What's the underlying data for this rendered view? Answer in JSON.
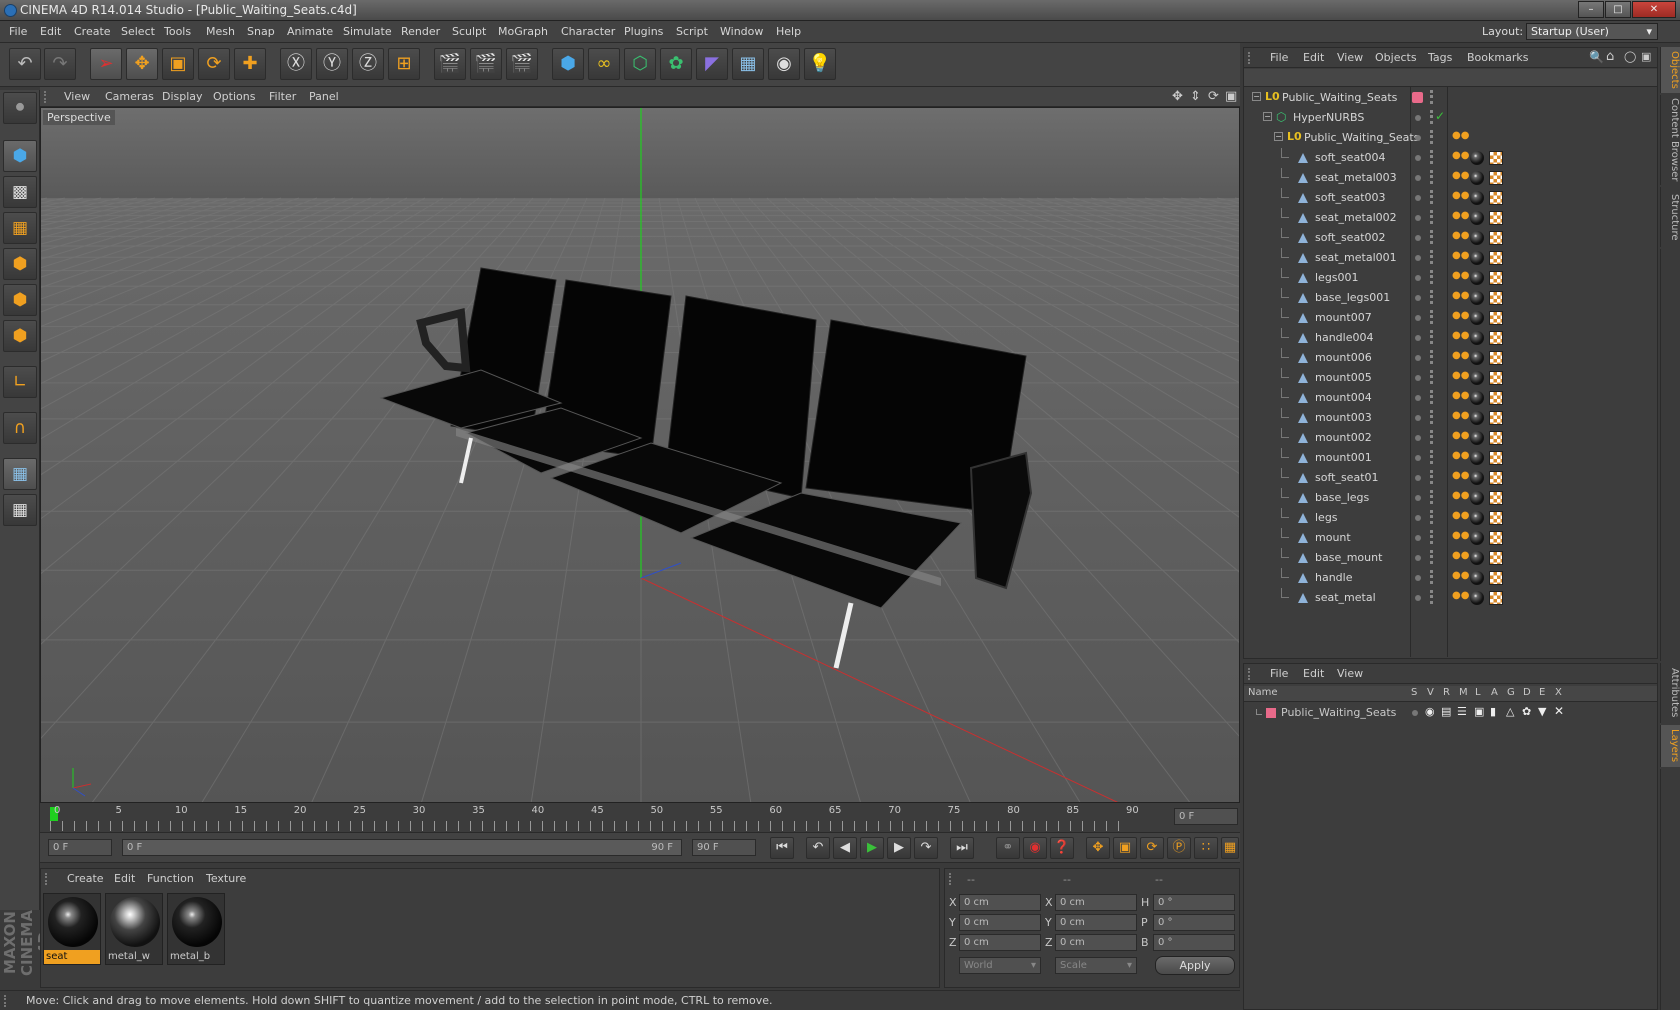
{
  "window": {
    "title": "CINEMA 4D R14.014 Studio - [Public_Waiting_Seats.c4d]"
  },
  "menubar": {
    "items": [
      "File",
      "Edit",
      "Create",
      "Select",
      "Tools",
      "Mesh",
      "Snap",
      "Animate",
      "Simulate",
      "Render",
      "Sculpt",
      "MoGraph",
      "Character",
      "Plugins",
      "Script",
      "Window",
      "Help"
    ],
    "layout_label": "Layout:",
    "layout_value": "Startup (User)"
  },
  "viewport": {
    "menu": [
      "View",
      "Cameras",
      "Display",
      "Options",
      "Filter",
      "Panel"
    ],
    "label": "Perspective"
  },
  "timeline": {
    "ticks": [
      "0",
      "5",
      "10",
      "15",
      "20",
      "25",
      "30",
      "35",
      "40",
      "45",
      "50",
      "55",
      "60",
      "65",
      "70",
      "75",
      "80",
      "85",
      "90"
    ],
    "current_frame": "0 F"
  },
  "transport": {
    "start": "0 F",
    "range_start": "0 F",
    "range_end": "90 F",
    "end": "90 F"
  },
  "material_manager": {
    "menu": [
      "Create",
      "Edit",
      "Function",
      "Texture"
    ],
    "materials": [
      {
        "name": "seat",
        "selected": true
      },
      {
        "name": "metal_w",
        "selected": false
      },
      {
        "name": "metal_b",
        "selected": false
      }
    ]
  },
  "coordinates": {
    "headers": [
      "--",
      "--",
      "--"
    ],
    "rows": [
      {
        "a": "X",
        "av": "0 cm",
        "b": "X",
        "bv": "0 cm",
        "c": "H",
        "cv": "0 °"
      },
      {
        "a": "Y",
        "av": "0 cm",
        "b": "Y",
        "bv": "0 cm",
        "c": "P",
        "cv": "0 °"
      },
      {
        "a": "Z",
        "av": "0 cm",
        "b": "Z",
        "bv": "0 cm",
        "c": "B",
        "cv": "0 °"
      }
    ],
    "mode": "World",
    "type": "Scale",
    "apply": "Apply"
  },
  "object_manager": {
    "menu": [
      "File",
      "Edit",
      "View",
      "Objects",
      "Tags",
      "Bookmarks"
    ],
    "tree": [
      {
        "name": "Public_Waiting_Seats",
        "level": 0,
        "kind": "null"
      },
      {
        "name": "HyperNURBS",
        "level": 1,
        "kind": "nurbs"
      },
      {
        "name": "Public_Waiting_Seats",
        "level": 2,
        "kind": "null"
      },
      {
        "name": "soft_seat004",
        "level": 3,
        "kind": "mesh"
      },
      {
        "name": "seat_metal003",
        "level": 3,
        "kind": "mesh"
      },
      {
        "name": "soft_seat003",
        "level": 3,
        "kind": "mesh"
      },
      {
        "name": "seat_metal002",
        "level": 3,
        "kind": "mesh"
      },
      {
        "name": "soft_seat002",
        "level": 3,
        "kind": "mesh"
      },
      {
        "name": "seat_metal001",
        "level": 3,
        "kind": "mesh"
      },
      {
        "name": "legs001",
        "level": 3,
        "kind": "mesh"
      },
      {
        "name": "base_legs001",
        "level": 3,
        "kind": "mesh"
      },
      {
        "name": "mount007",
        "level": 3,
        "kind": "mesh"
      },
      {
        "name": "handle004",
        "level": 3,
        "kind": "mesh"
      },
      {
        "name": "mount006",
        "level": 3,
        "kind": "mesh"
      },
      {
        "name": "mount005",
        "level": 3,
        "kind": "mesh"
      },
      {
        "name": "mount004",
        "level": 3,
        "kind": "mesh"
      },
      {
        "name": "mount003",
        "level": 3,
        "kind": "mesh"
      },
      {
        "name": "mount002",
        "level": 3,
        "kind": "mesh"
      },
      {
        "name": "mount001",
        "level": 3,
        "kind": "mesh"
      },
      {
        "name": "soft_seat01",
        "level": 3,
        "kind": "mesh"
      },
      {
        "name": "base_legs",
        "level": 3,
        "kind": "mesh"
      },
      {
        "name": "legs",
        "level": 3,
        "kind": "mesh"
      },
      {
        "name": "mount",
        "level": 3,
        "kind": "mesh"
      },
      {
        "name": "base_mount",
        "level": 3,
        "kind": "mesh"
      },
      {
        "name": "handle",
        "level": 3,
        "kind": "mesh"
      },
      {
        "name": "seat_metal",
        "level": 3,
        "kind": "mesh"
      }
    ]
  },
  "layer_manager": {
    "menu": [
      "File",
      "Edit",
      "View"
    ],
    "columns": [
      "Name",
      "S",
      "V",
      "R",
      "M",
      "L",
      "A",
      "G",
      "D",
      "E",
      "X"
    ],
    "layers": [
      {
        "name": "Public_Waiting_Seats",
        "color": "#e86a8a"
      }
    ]
  },
  "side_tabs": {
    "right_top": [
      "Objects",
      "Content Browser",
      "Structure"
    ],
    "right_bottom": [
      "Attributes",
      "Layers"
    ]
  },
  "branding": {
    "logo": "MAXON CINEMA 4D"
  },
  "statusbar": {
    "text": "Move: Click and drag to move elements. Hold down SHIFT to quantize movement / add to the selection in point mode, CTRL to remove."
  },
  "colors": {
    "accent": "#f0a020",
    "layer_color": "#e86a8a",
    "grid_green": "#1fd01f",
    "axis_red": "#c83030"
  }
}
